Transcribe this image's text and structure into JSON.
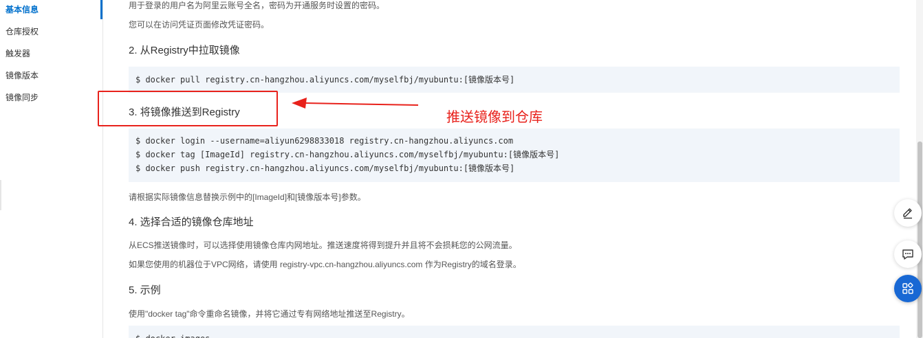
{
  "sidebar": {
    "items": [
      {
        "label": "基本信息",
        "active": true
      },
      {
        "label": "仓库授权"
      },
      {
        "label": "触发器"
      },
      {
        "label": "镜像版本"
      },
      {
        "label": "镜像同步"
      }
    ]
  },
  "content": {
    "intro_line1": "用于登录的用户名为阿里云账号全名，密码为开通服务时设置的密码。",
    "intro_line2": "您可以在访问凭证页面修改凭证密码。",
    "section2": {
      "title": "2. 从Registry中拉取镜像",
      "code": [
        "$ docker pull registry.cn-hangzhou.aliyuncs.com/myselfbj/myubuntu:[镜像版本号]"
      ]
    },
    "section3": {
      "title": "3. 将镜像推送到Registry",
      "code": [
        "$ docker login --username=aliyun6298833018 registry.cn-hangzhou.aliyuncs.com",
        "$ docker tag [ImageId] registry.cn-hangzhou.aliyuncs.com/myselfbj/myubuntu:[镜像版本号]",
        "$ docker push registry.cn-hangzhou.aliyuncs.com/myselfbj/myubuntu:[镜像版本号]"
      ],
      "note": "请根据实际镜像信息替换示例中的[ImageId]和[镜像版本号]参数。"
    },
    "section4": {
      "title": "4. 选择合适的镜像仓库地址",
      "line1": "从ECS推送镜像时，可以选择使用镜像仓库内网地址。推送速度将得到提升并且将不会损耗您的公网流量。",
      "line2": "如果您使用的机器位于VPC网络，请使用 registry-vpc.cn-hangzhou.aliyuncs.com 作为Registry的域名登录。"
    },
    "section5": {
      "title": "5. 示例",
      "line1": "使用\"docker tag\"命令重命名镜像，并将它通过专有网络地址推送至Registry。",
      "code_partial": "$ docker images"
    }
  },
  "annotation": {
    "label": "推送镜像到仓库",
    "color": "#e8211b"
  },
  "floating_buttons": [
    {
      "icon": "edit-icon"
    },
    {
      "icon": "feedback-icon"
    },
    {
      "icon": "apps-icon"
    }
  ],
  "colors": {
    "accent": "#0070cc",
    "code_bg": "#f1f5fa",
    "fab_primary": "#1868d4"
  }
}
